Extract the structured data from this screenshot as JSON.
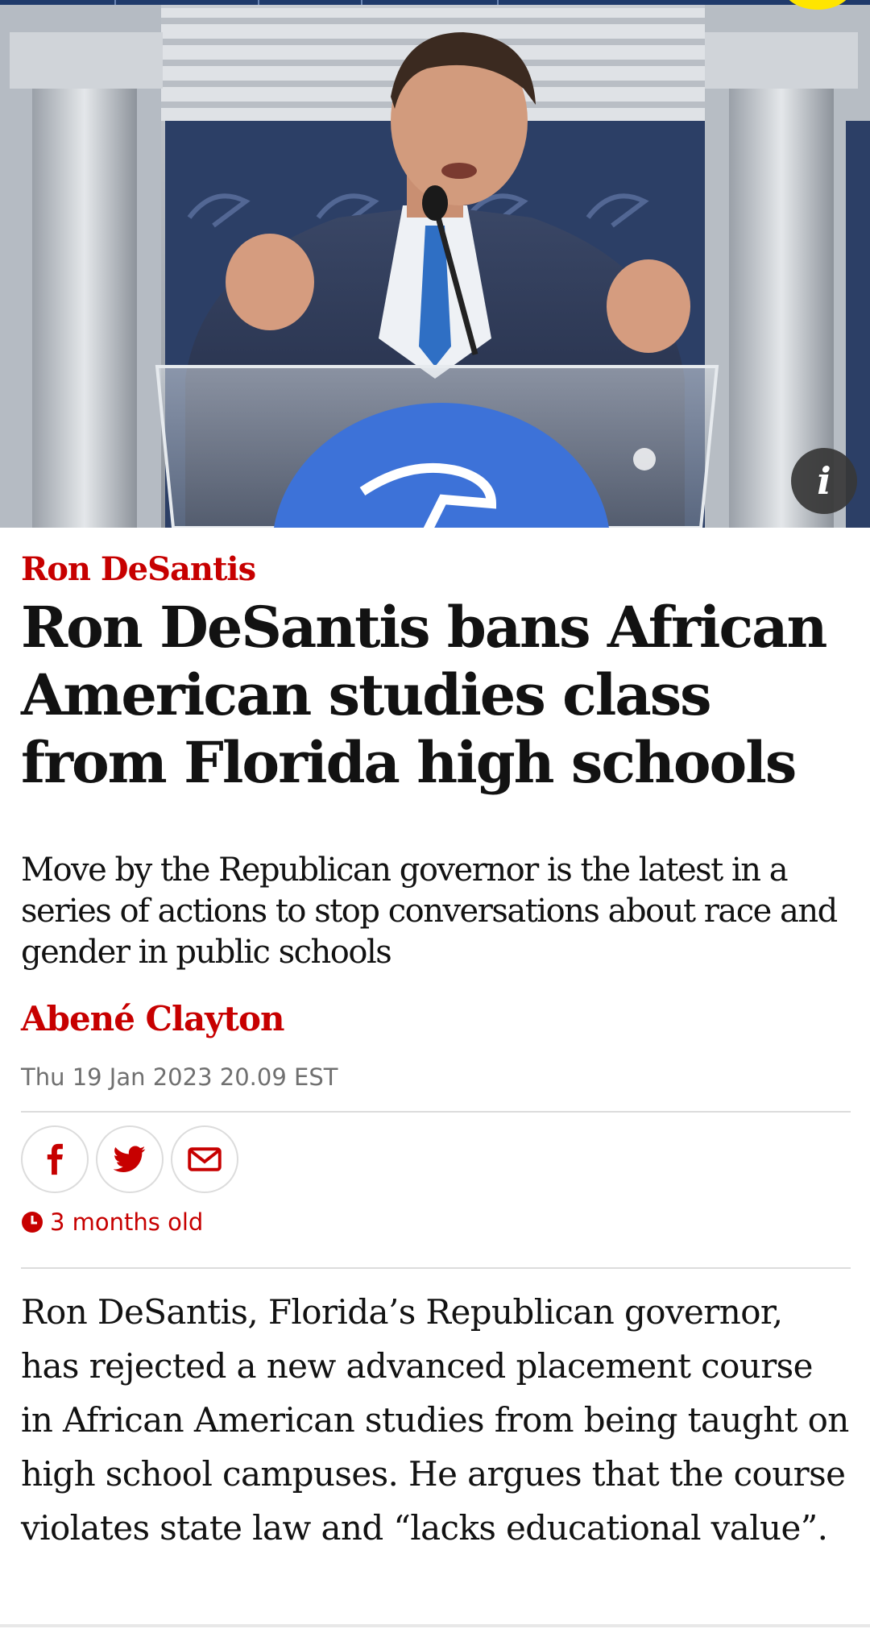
{
  "hero": {
    "image_alt": "Ron DeSantis speaking at a podium",
    "info_label": "i"
  },
  "article": {
    "kicker": "Ron DeSantis",
    "headline": "Ron DeSantis bans African American studies class from Florida high schools",
    "standfirst": "Move by the Republican governor is the latest in a series of actions to stop conversations about race and gender in public schools",
    "byline": "Abené Clayton",
    "dateline": "Thu 19 Jan 2023 20.09 EST",
    "age": "3 months old",
    "body": "Ron DeSantis, Florida’s Republican governor, has rejected a new advanced placement course in African American studies from being taught on high school campuses. He argues that the course violates state law and “lacks educational value”."
  },
  "share": [
    {
      "name": "facebook-icon"
    },
    {
      "name": "twitter-icon"
    },
    {
      "name": "email-icon"
    }
  ],
  "colors": {
    "accent": "#c70000",
    "text": "#121212",
    "muted": "#707070",
    "rule": "#dcdcdc"
  }
}
